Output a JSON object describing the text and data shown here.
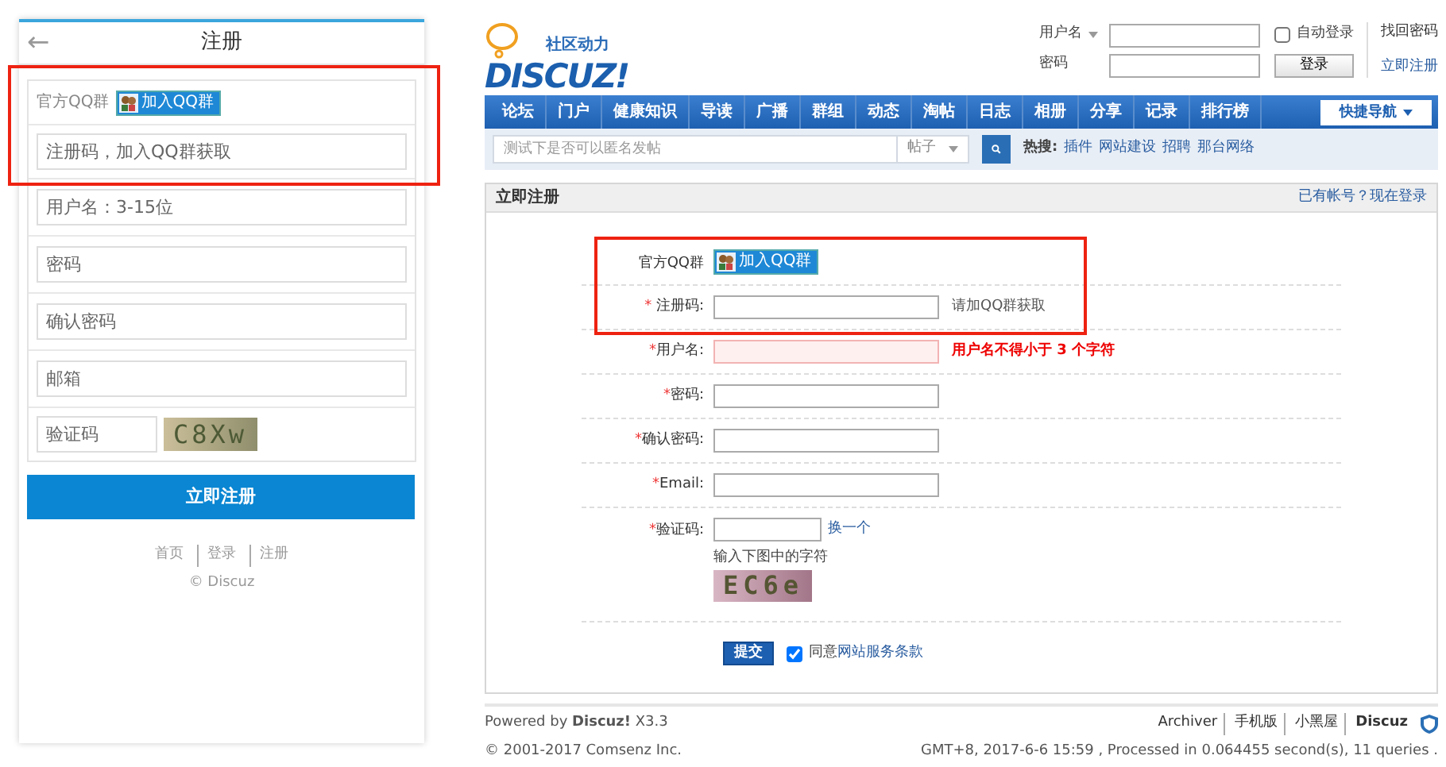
{
  "mobile": {
    "back_label": "←",
    "title": "注册",
    "qq_block": {
      "highlighted": true,
      "label": "官方QQ群",
      "button": "加入QQ群",
      "code_placeholder": "注册码，加入QQ群获取"
    },
    "fields": [
      {
        "placeholder": "用户名：3-15位"
      },
      {
        "placeholder": "密码"
      },
      {
        "placeholder": "确认密码"
      },
      {
        "placeholder": "邮箱"
      }
    ],
    "captcha": {
      "placeholder": "验证码",
      "image_text": "C8Xw"
    },
    "submit": "立即注册",
    "links": [
      "首页",
      "登录",
      "注册"
    ],
    "copyright": "© Discuz"
  },
  "desktop": {
    "logo": {
      "tagline": "社区动力",
      "wordmark": "DISCUZ!"
    },
    "login": {
      "username_label": "用户名",
      "password_label": "密码",
      "auto_login": {
        "label": "自动登录",
        "checked": false
      },
      "button": "登录",
      "links": [
        "找回密码",
        "立即注册"
      ]
    },
    "nav": {
      "items": [
        "论坛",
        "门户",
        "健康知识",
        "导读",
        "广播",
        "群组",
        "动态",
        "淘帖",
        "日志",
        "相册",
        "分享",
        "记录",
        "排行榜"
      ],
      "quick": "快捷导航"
    },
    "search": {
      "placeholder": "测试下是否可以匿名发帖",
      "scope": "帖子",
      "hot_label": "热搜:",
      "hot_links": [
        "插件",
        "网站建设",
        "招聘",
        "那台网络"
      ]
    },
    "panel": {
      "title": "立即注册",
      "login_link": "已有帐号？现在登录",
      "qq_block": {
        "highlighted": true,
        "label": "官方QQ群",
        "button": "加入QQ群",
        "code": {
          "required_mark": "*",
          "label": "注册码:",
          "hint": "请加QQ群获取"
        }
      },
      "fields": [
        {
          "required_mark": "*",
          "label": "用户名:",
          "error": "用户名不得小于 3 个字符"
        },
        {
          "required_mark": "*",
          "label": "密码:"
        },
        {
          "required_mark": "*",
          "label": "确认密码:"
        },
        {
          "required_mark": "*",
          "label": "Email:"
        }
      ],
      "captcha": {
        "required_mark": "*",
        "label": "验证码:",
        "refresh": "换一个",
        "hint": "输入下图中的字符",
        "image_text": "EC6e"
      },
      "submit": "提交",
      "agree": {
        "checked": true,
        "text": "同意",
        "link": "网站服务条款"
      }
    },
    "footer": {
      "powered": "Powered by **Discuz!** X3.3",
      "copyright": "© 2001-2017 Comsenz Inc.",
      "links": [
        "Archiver",
        "手机版",
        "小黑屋",
        "Discuz"
      ],
      "stats": "GMT+8, 2017-6-6 15:59 , Processed in 0.064455 second(s), 11 queries ."
    }
  }
}
